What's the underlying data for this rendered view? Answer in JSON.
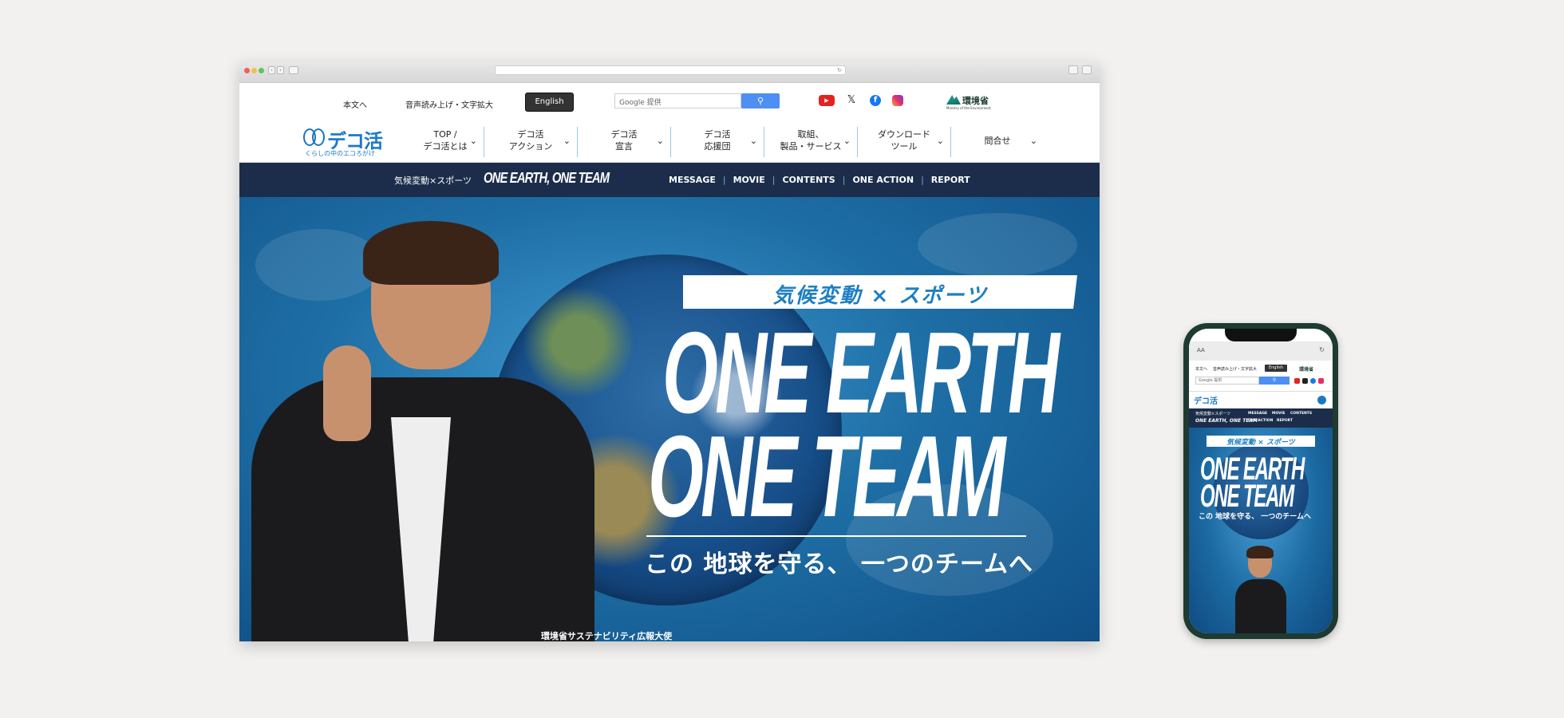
{
  "utility": {
    "skip_link": "本文へ",
    "accessibility": "音声読み上げ・文字拡大",
    "english": "English",
    "search_brand": "Google 提供",
    "search_button_icon": "search-icon",
    "sns": [
      "youtube-icon",
      "x-icon",
      "facebook-icon",
      "instagram-icon"
    ],
    "ministry_name": "環境省",
    "ministry_sub": "Ministry of the Environment"
  },
  "logo": {
    "name": "デコ活",
    "tagline": "くらしの中のエコろがけ"
  },
  "nav": [
    {
      "line1": "TOP /",
      "line2": "デコ活とは"
    },
    {
      "line1": "デコ活",
      "line2": "アクション"
    },
    {
      "line1": "デコ活",
      "line2": "宣言"
    },
    {
      "line1": "デコ活",
      "line2": "応援団"
    },
    {
      "line1": "取組、",
      "line2": "製品・サービス"
    },
    {
      "line1": "ダウンロード",
      "line2": "ツール"
    },
    {
      "line1": "問合せ",
      "line2": ""
    }
  ],
  "subbar": {
    "title": "気候変動×スポーツ",
    "brand": "ONE EARTH, ONE TEAM",
    "links": [
      "MESSAGE",
      "MOVIE",
      "CONTENTS",
      "ONE ACTION",
      "REPORT"
    ]
  },
  "hero": {
    "banner": "気候変動 × スポーツ",
    "line1": "ONE EARTH",
    "line2": "ONE TEAM",
    "subtitle": "この 地球を守る、 一つのチームへ",
    "caption": "環境省サステナビリティ広報大使"
  },
  "phone": {
    "aa": "AA",
    "reload": "↻",
    "skip_link": "本文へ",
    "accessibility": "音声読み上げ・文字拡大",
    "english": "English",
    "ministry_name": "環境省",
    "search_brand": "Google 提供",
    "logo": "デコ活",
    "sub_title": "気候変動×スポーツ",
    "sub_brand": "ONE EARTH, ONE TEAM",
    "links_row1": [
      "MESSAGE",
      "MOVIE",
      "CONTENTS"
    ],
    "links_row2": [
      "ONE ACTION",
      "REPORT"
    ],
    "banner": "気候変動 × スポーツ",
    "line1": "ONE EARTH",
    "line2": "ONE TEAM",
    "subtitle": "この 地球を守る、 一つのチームへ"
  },
  "colors": {
    "brand_blue": "#1a78c8",
    "navy": "#1b2d4a",
    "search_blue": "#4d8ff2",
    "youtube_red": "#e32320"
  }
}
